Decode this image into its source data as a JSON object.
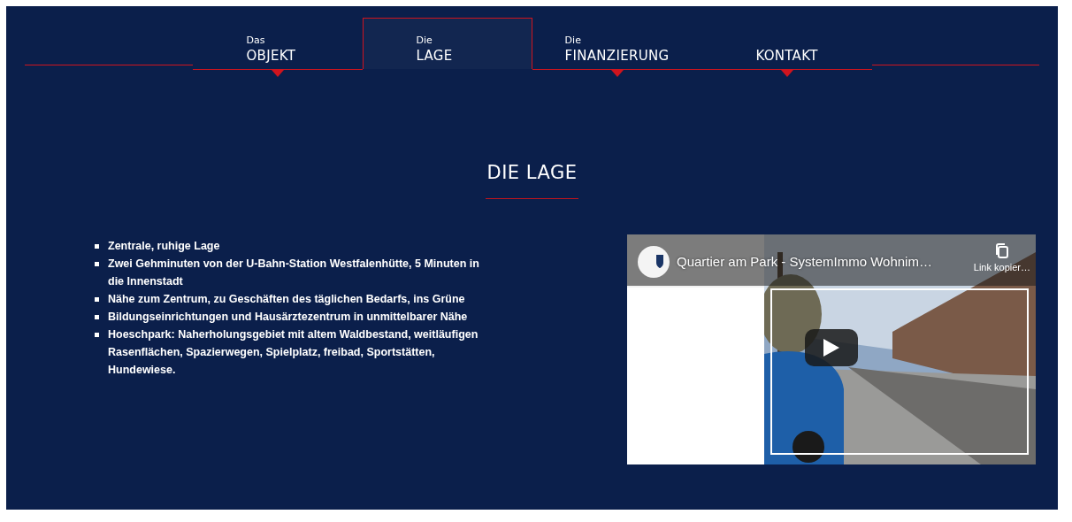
{
  "nav": {
    "tabs": [
      {
        "prefix": "Das",
        "label": "OBJEKT",
        "selected": false
      },
      {
        "prefix": "Die",
        "label": "LAGE",
        "selected": true
      },
      {
        "prefix": "Die",
        "label": "FINANZIERUNG",
        "selected": false
      },
      {
        "label": "KONTAKT",
        "selected": false
      }
    ]
  },
  "section": {
    "title": "DIE LAGE",
    "features": [
      "Zentrale, ruhige Lage",
      "Zwei Gehminuten von der U-Bahn-Station Westfalenhütte, 5 Minuten in die Innenstadt",
      "Nähe zum Zentrum, zu Geschäften des täglichen Bedarfs, ins Grüne",
      "Bildungseinrichtungen und Hausärztezentrum in unmittelbarer Nähe",
      "Hoeschpark: Naherholungsgebiet mit altem Waldbestand, weitläufigen Rasenflächen, Spazierwegen, Spielplatz, freibad, Sportstätten, Hundewiese."
    ],
    "video": {
      "kind": "picture",
      "title": "Quartier am Park - SystemImmo Wohnim…",
      "copy_label": "Link kopier…"
    }
  }
}
